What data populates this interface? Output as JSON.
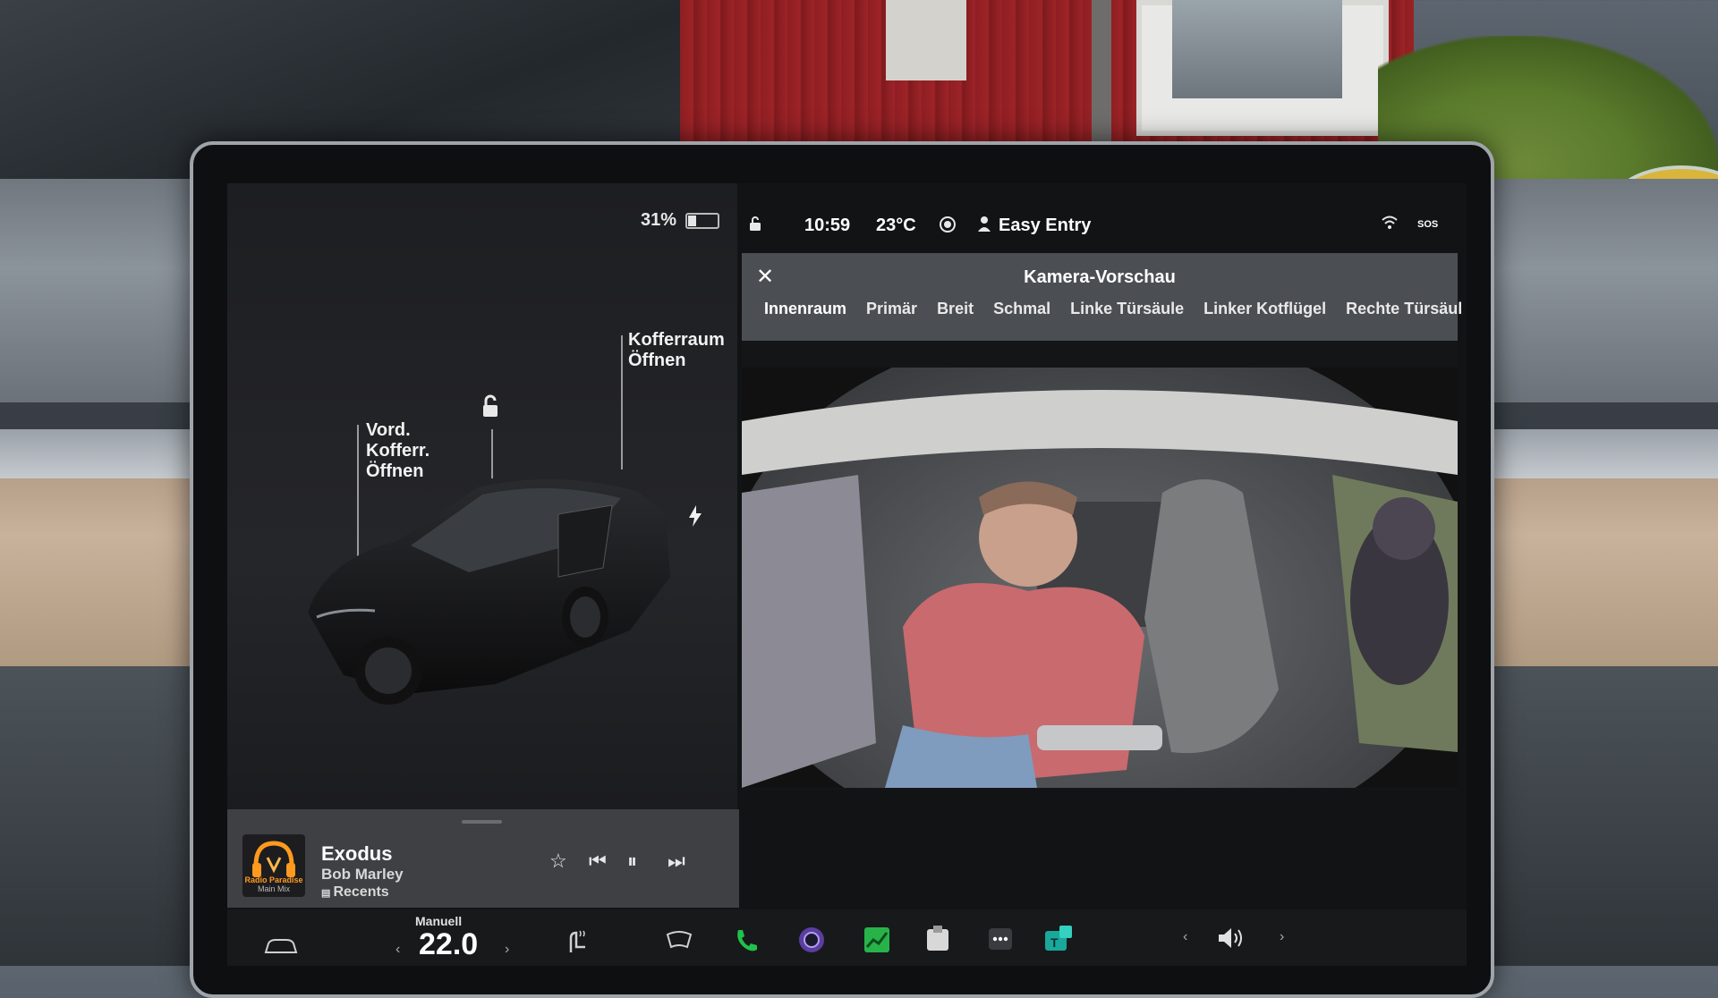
{
  "status_bar": {
    "battery_percent": "31%",
    "battery_level": 0.31,
    "time": "10:59",
    "temperature": "23°C",
    "driver_profile": "Easy Entry",
    "sos": "SOS"
  },
  "car_panel": {
    "front_trunk_label": "Vord.\nKofferr.\nÖffnen",
    "trunk_label": "Kofferraum\nÖffnen"
  },
  "camera_window": {
    "title": "Kamera-Vorschau",
    "tabs": [
      "Innenraum",
      "Primär",
      "Breit",
      "Schmal",
      "Linke Türsäule",
      "Linker Kotflügel",
      "Rechte Türsäul"
    ],
    "active_tab": "Innenraum"
  },
  "media_player": {
    "album_art_line1": "Radio Paradise",
    "album_art_line2": "Main Mix",
    "title": "Exodus",
    "artist": "Bob Marley",
    "source": "Recents"
  },
  "dock": {
    "climate_mode": "Manuell",
    "climate_temp": "22.0"
  },
  "colors": {
    "screen_bg": "#121315",
    "camera_header": "#4b4e53",
    "media_bg": "#3e4044",
    "phone_green": "#1fc24a",
    "accent_teal": "#1aa89a"
  }
}
